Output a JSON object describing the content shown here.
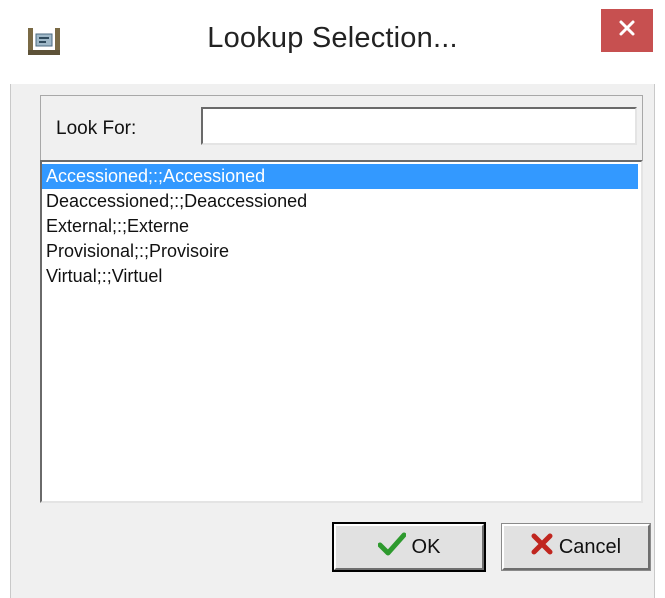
{
  "window": {
    "title": "Lookup Selection...",
    "app_icon": "lookup-app-icon",
    "close_icon": "close-icon"
  },
  "search": {
    "label": "Look For:",
    "value": "",
    "placeholder": ""
  },
  "list": {
    "items": [
      "Accessioned;:;Accessioned",
      "Deaccessioned;:;Deaccessioned",
      "External;:;Externe",
      "Provisional;:;Provisoire",
      "Virtual;:;Virtuel"
    ],
    "selected_index": 0
  },
  "buttons": {
    "ok_label": "OK",
    "ok_icon": "checkmark-icon",
    "cancel_label": "Cancel",
    "cancel_icon": "x-icon"
  },
  "colors": {
    "selection": "#3399ff",
    "close_button": "#c75050",
    "ok_check": "#2e9a2e",
    "cancel_x": "#c0261f"
  }
}
